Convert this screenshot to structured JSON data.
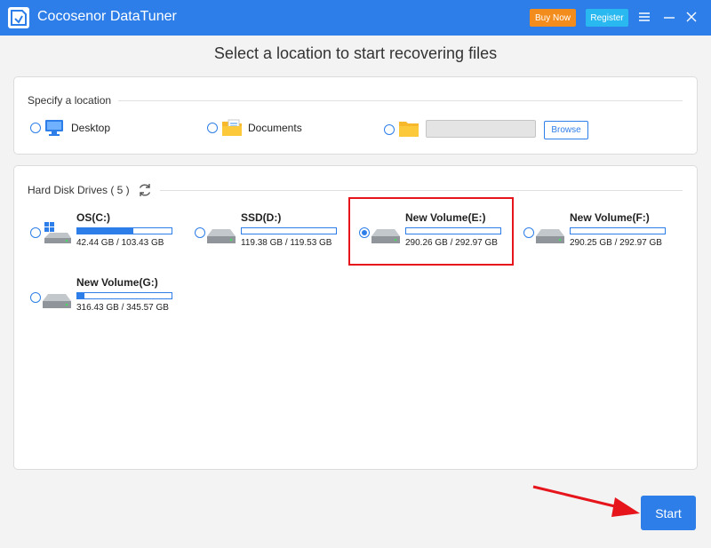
{
  "app": {
    "title": "Cocosenor DataTuner",
    "buy_label": "Buy Now",
    "register_label": "Register"
  },
  "heading": "Select a location to start recovering files",
  "location": {
    "section_label": "Specify a location",
    "options": [
      {
        "label": "Desktop",
        "icon": "monitor-icon",
        "selected": false
      },
      {
        "label": "Documents",
        "icon": "documents-folder-icon",
        "selected": false
      },
      {
        "label": "",
        "icon": "folder-icon",
        "selected": false
      }
    ],
    "path_value": "",
    "browse_label": "Browse"
  },
  "drives": {
    "section_label": "Hard Disk Drives ( 5 )",
    "items": [
      {
        "name": "OS(C:)",
        "size": "42.44 GB / 103.43 GB",
        "used_fraction": 0.59,
        "selected": false,
        "icon": "windows-drive-icon"
      },
      {
        "name": "SSD(D:)",
        "size": "119.38 GB / 119.53 GB",
        "used_fraction": 0.0,
        "selected": false,
        "icon": "hard-drive-icon"
      },
      {
        "name": "New Volume(E:)",
        "size": "290.26 GB / 292.97 GB",
        "used_fraction": 0.0,
        "selected": true,
        "icon": "hard-drive-icon"
      },
      {
        "name": "New Volume(F:)",
        "size": "290.25 GB / 292.97 GB",
        "used_fraction": 0.0,
        "selected": false,
        "icon": "hard-drive-icon"
      },
      {
        "name": "New Volume(G:)",
        "size": "316.43 GB / 345.57 GB",
        "used_fraction": 0.08,
        "selected": false,
        "icon": "hard-drive-icon"
      }
    ]
  },
  "start_label": "Start",
  "colors": {
    "accent": "#2d7ee8",
    "buy": "#f28c1d",
    "register": "#29b8ef",
    "highlight": "#e6141b"
  }
}
